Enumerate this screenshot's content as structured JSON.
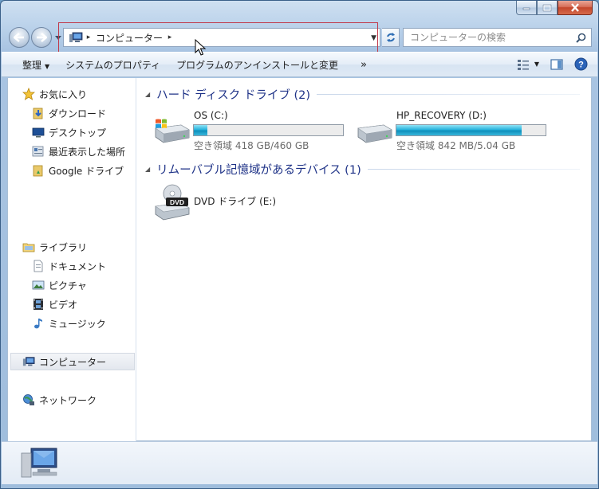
{
  "window": {
    "caption": {
      "minimize": "minimize",
      "maximize": "maximize",
      "close": "close"
    }
  },
  "address": {
    "crumbs": [
      "コンピューター"
    ]
  },
  "search": {
    "placeholder": "コンピューターの検索"
  },
  "toolbar": {
    "organize": "整理",
    "system_properties": "システムのプロパティ",
    "uninstall": "プログラムのアンインストールと変更",
    "more": "»"
  },
  "navpane": {
    "favorites": {
      "label": "お気に入り",
      "items": [
        "ダウンロード",
        "デスクトップ",
        "最近表示した場所",
        "Google ドライブ"
      ]
    },
    "libraries": {
      "label": "ライブラリ",
      "items": [
        "ドキュメント",
        "ピクチャ",
        "ビデオ",
        "ミュージック"
      ]
    },
    "computer": "コンピューター",
    "network": "ネットワーク"
  },
  "groups": {
    "hdd": {
      "title": "ハード ディスク ドライブ (2)",
      "drives": [
        {
          "name": "OS (C:)",
          "space": "空き領域 418 GB/460 GB",
          "used_fraction": 0.09
        },
        {
          "name": "HP_RECOVERY (D:)",
          "space": "空き領域 842 MB/5.04 GB",
          "used_fraction": 0.84
        }
      ]
    },
    "removable": {
      "title": "リムーバブル記憶域があるデバイス (1)",
      "drives": [
        {
          "name": "DVD ドライブ (E:)"
        }
      ]
    }
  },
  "icons": {
    "dvd_label": "DVD"
  },
  "colors": {
    "group_header": "#1e3287",
    "highlight_box": "#c0394a",
    "bar_fill": "#27b3dc"
  }
}
